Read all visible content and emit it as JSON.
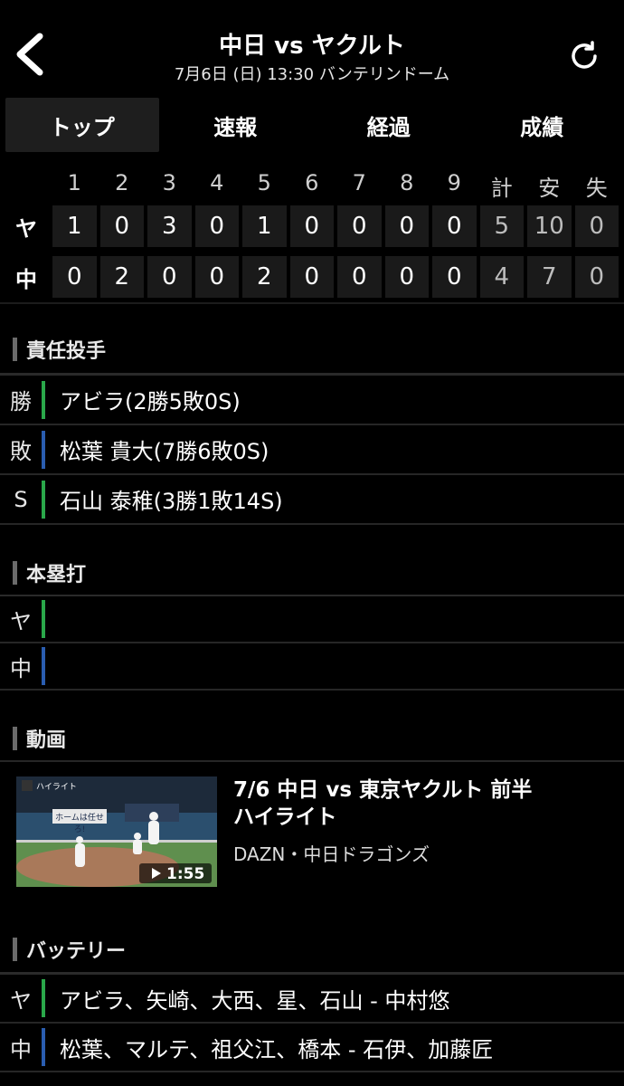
{
  "header": {
    "title": "中日 vs ヤクルト",
    "subtitle": "7月6日 (日) 13:30 バンテリンドーム"
  },
  "tabs": [
    {
      "label": "トップ",
      "active": true
    },
    {
      "label": "速報",
      "active": false
    },
    {
      "label": "経過",
      "active": false
    },
    {
      "label": "成績",
      "active": false
    }
  ],
  "scoreboard": {
    "headers": [
      "1",
      "2",
      "3",
      "4",
      "5",
      "6",
      "7",
      "8",
      "9",
      "計",
      "安",
      "失"
    ],
    "rows": [
      {
        "team": "ヤ",
        "cells": [
          "1",
          "0",
          "3",
          "0",
          "1",
          "0",
          "0",
          "0",
          "0",
          "5",
          "10",
          "0"
        ]
      },
      {
        "team": "中",
        "cells": [
          "0",
          "2",
          "0",
          "0",
          "2",
          "0",
          "0",
          "0",
          "0",
          "4",
          "7",
          "0"
        ]
      }
    ]
  },
  "pitchers": {
    "heading": "責任投手",
    "rows": [
      {
        "label": "勝",
        "text": "アビラ(2勝5敗0S)",
        "color": "#2aa84a"
      },
      {
        "label": "敗",
        "text": "松葉 貴大(7勝6敗0S)",
        "color": "#2a5db0"
      },
      {
        "label": "S",
        "text": "石山 泰稚(3勝1敗14S)",
        "color": "#2aa84a"
      }
    ]
  },
  "homeruns": {
    "heading": "本塁打",
    "rows": [
      {
        "label": "ヤ",
        "text": "",
        "color": "#2aa84a"
      },
      {
        "label": "中",
        "text": "",
        "color": "#2a5db0"
      }
    ]
  },
  "video": {
    "heading": "動画",
    "title_line1": "7/6 中日 vs 東京ヤクルト  前半",
    "title_line2": "ハイライト",
    "source": "DAZN・中日ドラゴンズ",
    "duration": "1:55",
    "thumb_badge": "ハイライト",
    "thumb_sign": "ホームは任せろ!"
  },
  "battery": {
    "heading": "バッテリー",
    "rows": [
      {
        "label": "ヤ",
        "text": "アビラ、矢崎、大西、星、石山 - 中村悠",
        "color": "#2aa84a"
      },
      {
        "label": "中",
        "text": "松葉、マルテ、祖父江、橋本 - 石伊、加藤匠",
        "color": "#2a5db0"
      }
    ]
  }
}
